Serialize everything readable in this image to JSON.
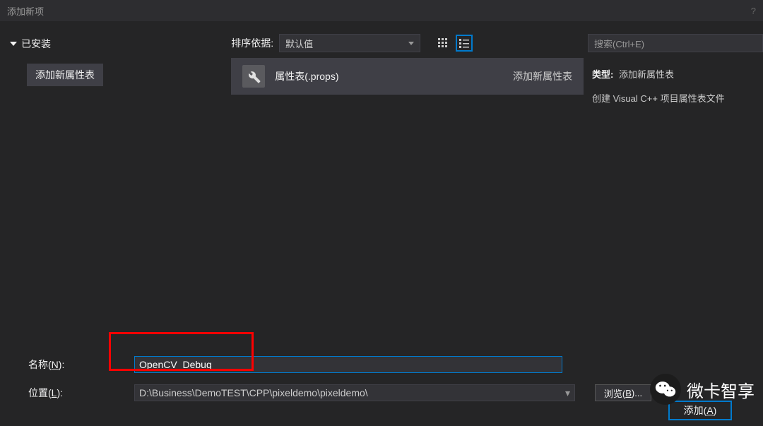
{
  "titlebar": {
    "title": "添加新项",
    "help": "?"
  },
  "sidebar": {
    "root": "已安装",
    "child": "添加新属性表"
  },
  "toolbar": {
    "sort_label": "排序依据:",
    "sort_value": "默认值"
  },
  "template": {
    "name": "属性表(.props)",
    "type": "添加新属性表"
  },
  "search": {
    "placeholder": "搜索(Ctrl+E)"
  },
  "description": {
    "type_label": "类型:",
    "type_value": "添加新属性表",
    "line2": "创建 Visual C++ 项目属性表文件"
  },
  "form": {
    "name_label_pre": "名称(",
    "name_label_u": "N",
    "name_label_post": "):",
    "name_value": "OpenCV_Debug",
    "loc_label_pre": "位置(",
    "loc_label_u": "L",
    "loc_label_post": "):",
    "loc_value": "D:\\Business\\DemoTEST\\CPP\\pixeldemo\\pixeldemo\\",
    "browse_pre": "浏览(",
    "browse_u": "B",
    "browse_post": ")...",
    "add_pre": "添加(",
    "add_u": "A",
    "add_post": ")"
  },
  "watermark": {
    "text": "微卡智享"
  }
}
